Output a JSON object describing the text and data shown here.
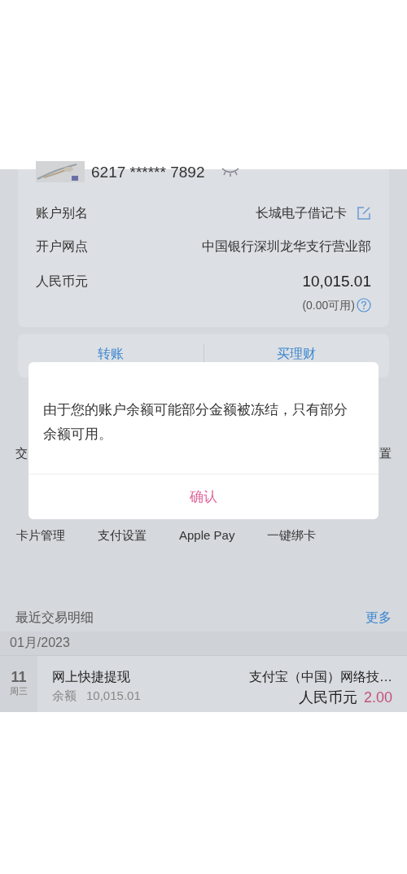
{
  "account_card": {
    "card_number": "6217 ****** 7892",
    "rows": [
      {
        "label": "账户别名",
        "value": "长城电子借记卡",
        "editable": true
      },
      {
        "label": "开户网点",
        "value": "中国银行深圳龙华支行营业部",
        "editable": false
      },
      {
        "label": "人民币元",
        "value": "10,015.01",
        "editable": false
      }
    ],
    "available": "(0.00可用)"
  },
  "actions": [
    "转账",
    "买理财"
  ],
  "function_row_partial": [
    "交",
    "置"
  ],
  "functions": [
    "卡片管理",
    "支付设置",
    "Apple Pay",
    "一键绑卡"
  ],
  "recent": {
    "title": "最近交易明细",
    "more": "更多",
    "month": "01月/2023",
    "transactions": [
      {
        "day": "11",
        "weekday": "周三",
        "title": "网上快捷提现",
        "balance_label": "余额",
        "balance": "10,015.01",
        "counterparty": "支付宝（中国）网络技…",
        "currency": "人民币元",
        "amount": "2.00"
      }
    ]
  },
  "dialog": {
    "message": "由于您的账户余额可能部分金额被冻结，只有部分余额可用。",
    "confirm": "确认"
  }
}
